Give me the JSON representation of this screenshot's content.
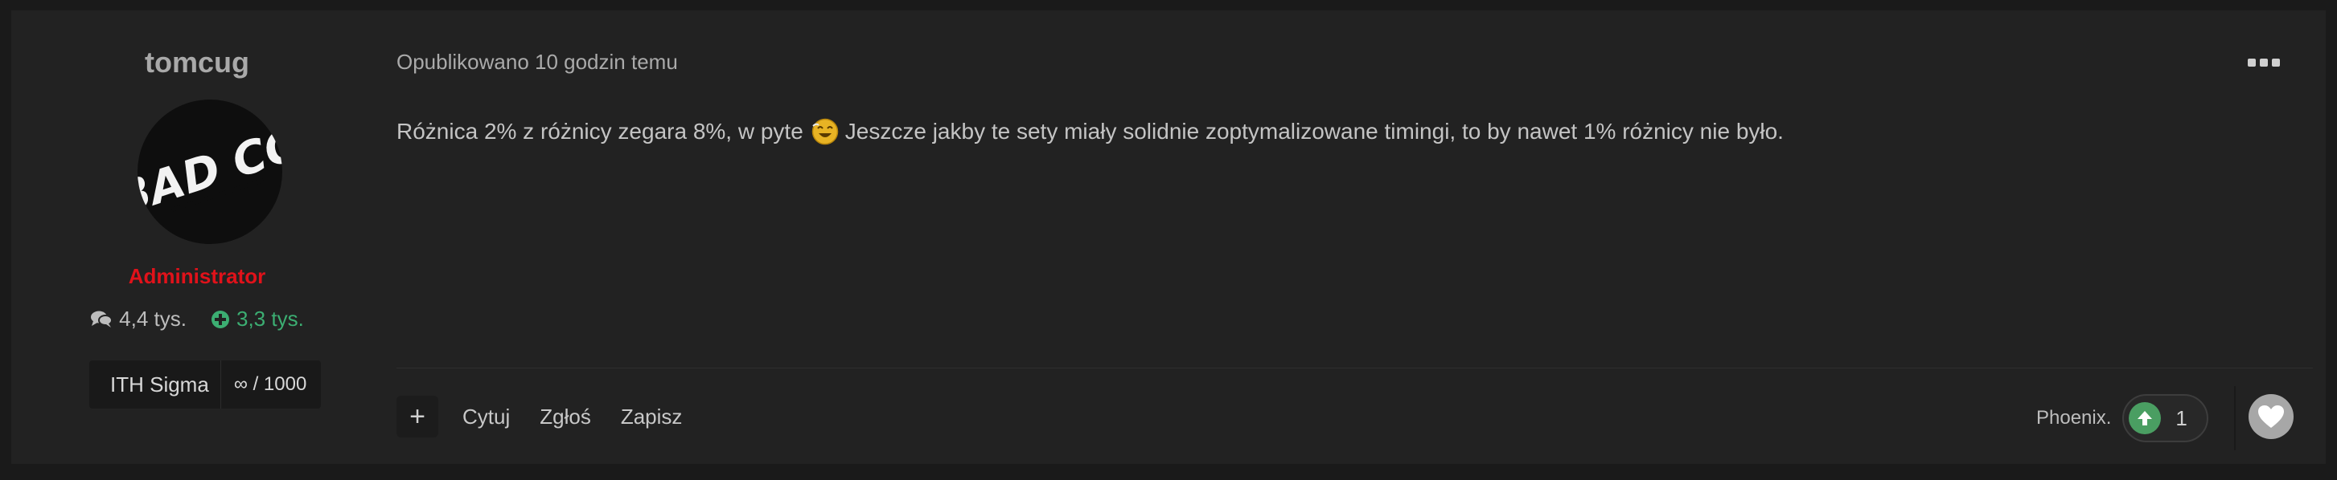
{
  "author": {
    "username": "tomcug",
    "role": "Administrator",
    "posts_count": "4,4 tys.",
    "reputation": "3,3 tys.",
    "badge": {
      "name": "ITH Sigma",
      "points": "∞ / 1000"
    },
    "avatar_text": "BAD CO"
  },
  "post": {
    "meta": "Opublikowano 10 godzin temu",
    "text_before_emoji": "Różnica 2% z różnicy zegara 8%, w pyte",
    "text_after_emoji": "Jeszcze jakby te sety miały solidnie zoptymalizowane timingi, to by nawet 1% różnicy nie było.",
    "emoji": "laughing-emoji"
  },
  "footer": {
    "plus_label": "+",
    "quote_label": "Cytuj",
    "report_label": "Zgłoś",
    "save_label": "Zapisz",
    "reacted_by": "Phoenix.",
    "reaction_count": "1"
  },
  "colors": {
    "role": "#e0121a",
    "reputation": "#3cae72",
    "upvote": "#4a9e62"
  }
}
